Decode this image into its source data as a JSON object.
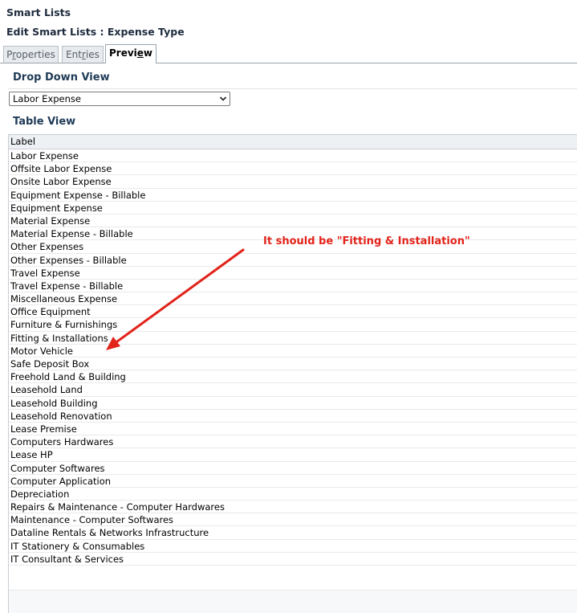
{
  "header": {
    "title": "Smart Lists",
    "subtitle": "Edit Smart Lists : Expense Type"
  },
  "tabs": [
    {
      "label_pre": "P",
      "label_ul": "r",
      "label_post": "operties",
      "active": false
    },
    {
      "label_pre": "Ent",
      "label_ul": "r",
      "label_post": "ies",
      "active": false
    },
    {
      "label_pre": "Previ",
      "label_ul": "e",
      "label_post": "w",
      "active": true
    }
  ],
  "dropdown_view": {
    "title": "Drop Down View",
    "selected": "Labor Expense"
  },
  "table_view": {
    "title": "Table View",
    "column_header": "Label",
    "rows": [
      "Labor Expense",
      "Offsite Labor Expense",
      "Onsite Labor Expense",
      "Equipment Expense - Billable",
      "Equipment Expense",
      "Material Expense",
      "Material Expense - Billable",
      "Other Expenses",
      "Other Expenses - Billable",
      "Travel Expense",
      "Travel Expense - Billable",
      "Miscellaneous Expense",
      "Office Equipment",
      "Furniture & Furnishings",
      "Fitting & Installations",
      "Motor Vehicle",
      "Safe Deposit Box",
      "Freehold Land & Building",
      "Leasehold Land",
      "Leasehold Building",
      "Leasehold Renovation",
      "Lease Premise",
      "Computers Hardwares",
      "Lease HP",
      "Computer Softwares",
      "Computer Application",
      "Depreciation",
      "Repairs & Maintenance - Computer Hardwares",
      "Maintenance - Computer Softwares",
      "Dataline Rentals & Networks Infrastructure",
      "IT Stationery & Consumables",
      "IT Consultant & Services"
    ]
  },
  "annotation": {
    "text": "It should be \"Fitting & Installation\"",
    "color": "#e2231a"
  }
}
